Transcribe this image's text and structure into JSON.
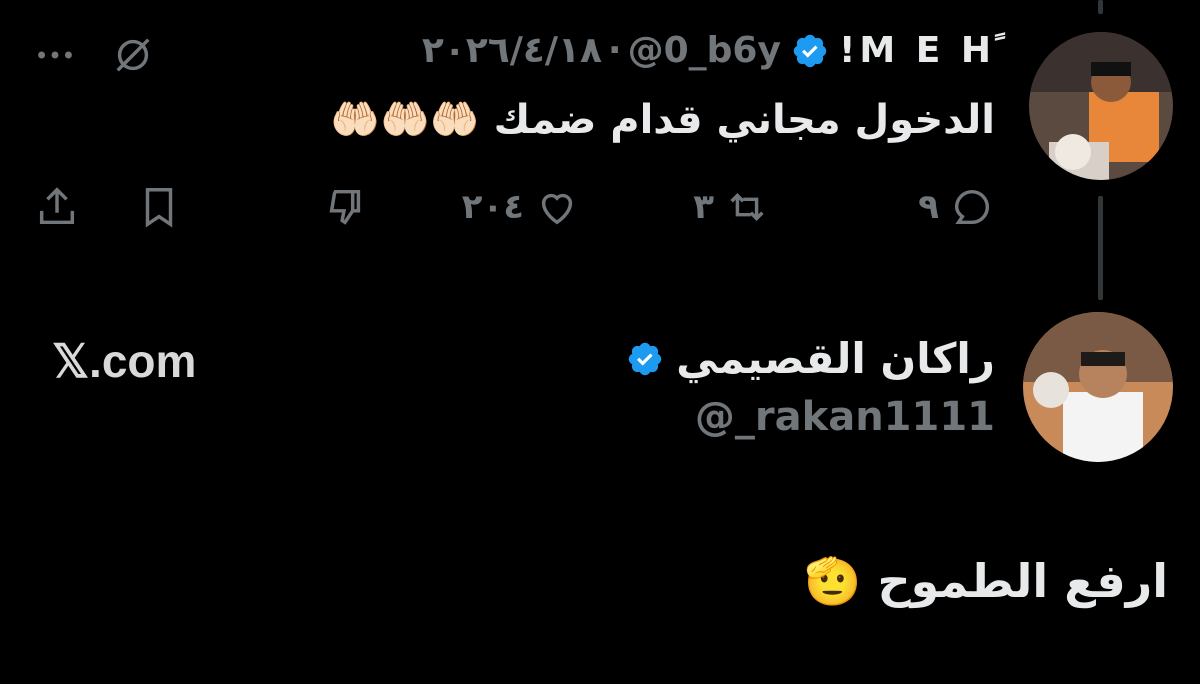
{
  "tweet": {
    "author_name": "M E Hً!",
    "handle": "@0_b6y",
    "separator": "·",
    "date": "٢٠٢٦/٤/١٨",
    "text": "الدخول مجاني قدام ضمك",
    "emoji": "🤲🏻🤲🏻🤲🏻",
    "actions": {
      "reply_count": "٩",
      "repost_count": "٣",
      "like_count": "٢٠٤"
    }
  },
  "card": {
    "display_name": "راكان القصيمي",
    "handle": "@_rakan1111",
    "logo_text": "𝕏.com",
    "post_text": "ارفع الطموح",
    "post_emoji": "🫡"
  },
  "colors": {
    "verified": "#1d9bf0",
    "muted": "#71767b",
    "text": "#e7e9ea"
  },
  "icons": [
    "more-icon",
    "grok-icon",
    "reply-icon",
    "repost-icon",
    "like-icon",
    "dislike-icon",
    "bookmark-icon",
    "share-icon",
    "verified-badge-icon"
  ]
}
